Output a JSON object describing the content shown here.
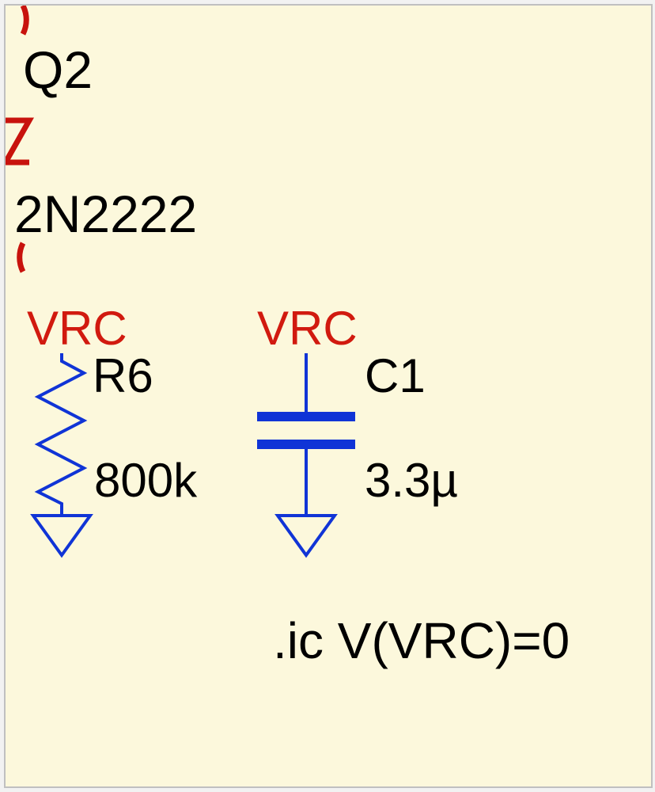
{
  "transistor": {
    "ref": "Q2",
    "model": "2N2222"
  },
  "resistor": {
    "net": "VRC",
    "ref": "R6",
    "value": "800k"
  },
  "capacitor": {
    "net": "VRC",
    "ref": "C1",
    "value": "3.3µ"
  },
  "directive": ".ic V(VRC)=0"
}
